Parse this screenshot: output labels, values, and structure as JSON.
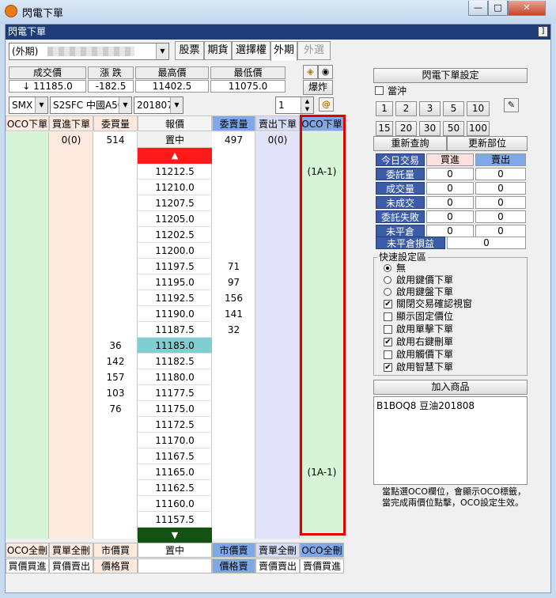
{
  "window": {
    "title": "閃電下單",
    "panel_title": "閃電下單",
    "pin_label": "]"
  },
  "product_combo": {
    "value": "(外期)"
  },
  "tabs": [
    {
      "label": "股票"
    },
    {
      "label": "期貨"
    },
    {
      "label": "選擇權"
    },
    {
      "label": "外期"
    },
    {
      "label": "外選"
    }
  ],
  "summary": {
    "headers": [
      "成交價",
      "漲 跌",
      "最高價",
      "最低價"
    ],
    "values": [
      "↓ 11185.0",
      "-182.5",
      "11402.5",
      "11075.0"
    ]
  },
  "burst_button": "爆炸",
  "selectors": {
    "exchange": "SMX",
    "symbol": "S2SFC 中國A50",
    "month": "201807",
    "quantity": "1"
  },
  "columns": {
    "left": [
      "OCO下單",
      "買進下單",
      "委買量"
    ],
    "price": "報價",
    "right": [
      "委賣量",
      "賣出下單",
      "OCO下單"
    ]
  },
  "top_row": {
    "buy_order": "0(0)",
    "bid_volume_total": "514",
    "center_label": "置中",
    "ask_volume_total": "497",
    "sell_order": "0(0)"
  },
  "ladder": [
    {
      "price": "11212.5",
      "bid": "",
      "ask": "",
      "oco_right": "(1A-1)"
    },
    {
      "price": "11210.0",
      "bid": "",
      "ask": "",
      "oco_right": ""
    },
    {
      "price": "11207.5",
      "bid": "",
      "ask": "",
      "oco_right": ""
    },
    {
      "price": "11205.0",
      "bid": "",
      "ask": "",
      "oco_right": ""
    },
    {
      "price": "11202.5",
      "bid": "",
      "ask": "",
      "oco_right": ""
    },
    {
      "price": "11200.0",
      "bid": "",
      "ask": "",
      "oco_right": ""
    },
    {
      "price": "11197.5",
      "bid": "",
      "ask": "71",
      "oco_right": ""
    },
    {
      "price": "11195.0",
      "bid": "",
      "ask": "97",
      "oco_right": ""
    },
    {
      "price": "11192.5",
      "bid": "",
      "ask": "156",
      "oco_right": ""
    },
    {
      "price": "11190.0",
      "bid": "",
      "ask": "141",
      "oco_right": ""
    },
    {
      "price": "11187.5",
      "bid": "",
      "ask": "32",
      "oco_right": ""
    },
    {
      "price": "11185.0",
      "bid": "36",
      "ask": "",
      "oco_right": "",
      "current": true
    },
    {
      "price": "11182.5",
      "bid": "142",
      "ask": "",
      "oco_right": ""
    },
    {
      "price": "11180.0",
      "bid": "157",
      "ask": "",
      "oco_right": ""
    },
    {
      "price": "11177.5",
      "bid": "103",
      "ask": "",
      "oco_right": ""
    },
    {
      "price": "11175.0",
      "bid": "76",
      "ask": "",
      "oco_right": ""
    },
    {
      "price": "11172.5",
      "bid": "",
      "ask": "",
      "oco_right": ""
    },
    {
      "price": "11170.0",
      "bid": "",
      "ask": "",
      "oco_right": ""
    },
    {
      "price": "11167.5",
      "bid": "",
      "ask": "",
      "oco_right": ""
    },
    {
      "price": "11165.0",
      "bid": "",
      "ask": "",
      "oco_right": "(1A-1)"
    },
    {
      "price": "11162.5",
      "bid": "",
      "ask": "",
      "oco_right": ""
    },
    {
      "price": "11160.0",
      "bid": "",
      "ask": "",
      "oco_right": ""
    },
    {
      "price": "11157.5",
      "bid": "",
      "ask": "",
      "oco_right": ""
    }
  ],
  "bottom_row1": [
    "OCO全刪",
    "買單全刪",
    "市價買",
    "置中",
    "市價賣",
    "賣單全刪",
    "OCO全刪"
  ],
  "bottom_row2": [
    "買價買進",
    "買價賣出",
    "價格買",
    "",
    "價格賣",
    "賣價賣出",
    "賣價買進"
  ],
  "right_panel": {
    "settings_button": "閃電下單設定",
    "day_trade_label": "當沖",
    "qty_row1": [
      "1",
      "2",
      "3",
      "5",
      "10"
    ],
    "qty_row2": [
      "15",
      "20",
      "30",
      "50",
      "100"
    ],
    "requery_button": "重新查詢",
    "update_button": "更新部位",
    "stats_header": [
      "今日交易",
      "買進",
      "賣出"
    ],
    "stats": [
      {
        "label": "委託量",
        "buy": "0",
        "sell": "0"
      },
      {
        "label": "成交量",
        "buy": "0",
        "sell": "0"
      },
      {
        "label": "未成交",
        "buy": "0",
        "sell": "0"
      },
      {
        "label": "委託失敗",
        "buy": "0",
        "sell": "0"
      },
      {
        "label": "未平倉",
        "buy": "0",
        "sell": "0"
      }
    ],
    "unrealized_label": "未平倉損益",
    "unrealized_value": "0",
    "quick_title": "快速設定區",
    "radios": [
      {
        "label": "無",
        "checked": true
      },
      {
        "label": "啟用鍵價下單",
        "checked": false
      },
      {
        "label": "啟用鍵盤下單",
        "checked": false
      }
    ],
    "checks": [
      {
        "label": "關閉交易確認視窗",
        "checked": true
      },
      {
        "label": "顯示固定價位",
        "checked": false
      },
      {
        "label": "啟用單擊下單",
        "checked": false
      },
      {
        "label": "啟用右鍵刪單",
        "checked": true
      },
      {
        "label": "啟用觸價下單",
        "checked": false
      },
      {
        "label": "啟用智慧下單",
        "checked": true
      }
    ],
    "add_product_button": "加入商品",
    "products_text": "B1BOQ8 豆油201808",
    "note_line1": "當點選OCO欄位，會顯示OCO標籤，",
    "note_line2": "當完成兩價位點擊，OCO設定生效。"
  },
  "colors": {
    "oco_bg": "#d6f5d6",
    "buy_bg": "#fde9de",
    "sell_bg": "#e2e2f8",
    "up_arrow_bg": "#ff1a1a",
    "down_arrow_bg": "#145214",
    "current_price_bg": "#7fcfd2",
    "frame": "#e00000"
  }
}
